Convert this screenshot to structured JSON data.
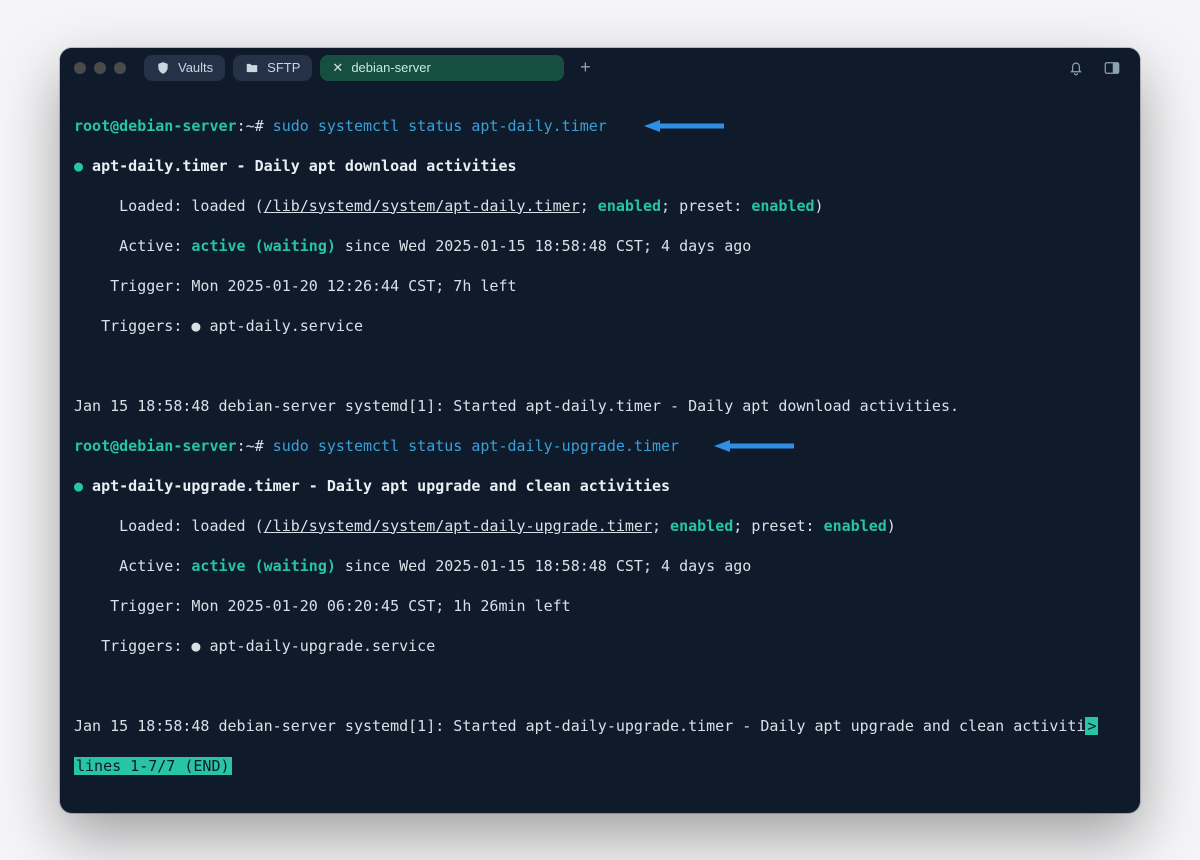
{
  "titlebar": {
    "tabs": [
      {
        "icon": "shield",
        "label": "Vaults"
      },
      {
        "icon": "folder",
        "label": "SFTP"
      }
    ],
    "active_tab": {
      "label": "debian-server"
    },
    "new_tab_glyph": "+"
  },
  "prompt1": {
    "user_host": "root@debian-server",
    "path": ":~#",
    "command": " sudo systemctl status apt-daily.timer"
  },
  "status1": {
    "title_line": " apt-daily.timer - Daily apt download activities",
    "loaded_prefix": "     Loaded: loaded (",
    "loaded_path": "/lib/systemd/system/apt-daily.timer",
    "loaded_mid1": "; ",
    "loaded_enabled": "enabled",
    "loaded_mid2": "; preset: ",
    "loaded_preset": "enabled",
    "loaded_suffix": ")",
    "active_prefix": "     Active: ",
    "active_state": "active (waiting)",
    "active_suffix": " since Wed 2025-01-15 18:58:48 CST; 4 days ago",
    "trigger": "    Trigger: Mon 2025-01-20 12:26:44 CST; 7h left",
    "triggers_prefix": "   Triggers: ",
    "triggers_bullet": "●",
    "triggers_svc": " apt-daily.service",
    "journal": "Jan 15 18:58:48 debian-server systemd[1]: Started apt-daily.timer - Daily apt download activities."
  },
  "prompt2": {
    "user_host": "root@debian-server",
    "path": ":~#",
    "command": " sudo systemctl status apt-daily-upgrade.timer"
  },
  "status2": {
    "title_line": " apt-daily-upgrade.timer - Daily apt upgrade and clean activities",
    "loaded_prefix": "     Loaded: loaded (",
    "loaded_path": "/lib/systemd/system/apt-daily-upgrade.timer",
    "loaded_mid1": "; ",
    "loaded_enabled": "enabled",
    "loaded_mid2": "; preset: ",
    "loaded_preset": "enabled",
    "loaded_suffix": ")",
    "active_prefix": "     Active: ",
    "active_state": "active (waiting)",
    "active_suffix": " since Wed 2025-01-15 18:58:48 CST; 4 days ago",
    "trigger": "    Trigger: Mon 2025-01-20 06:20:45 CST; 1h 26min left",
    "triggers_prefix": "   Triggers: ",
    "triggers_bullet": "●",
    "triggers_svc": " apt-daily-upgrade.service",
    "journal": "Jan 15 18:58:48 debian-server systemd[1]: Started apt-daily-upgrade.timer - Daily apt upgrade and clean activiti",
    "pager_overflow": ">",
    "pager": "lines 1-7/7 (END)"
  }
}
